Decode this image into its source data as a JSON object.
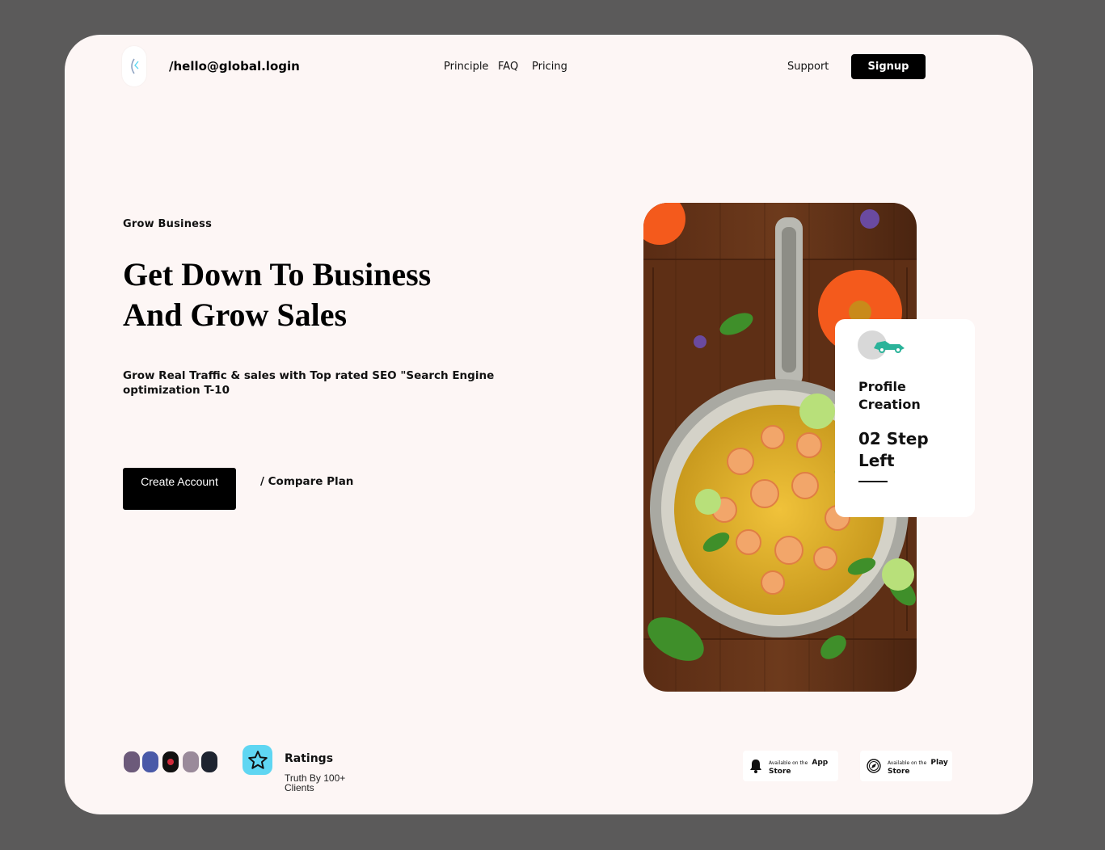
{
  "header": {
    "email": "/hello@global.login",
    "nav": [
      "Principle",
      "FAQ",
      "Pricing"
    ],
    "support": "Support",
    "signup": "Signup"
  },
  "hero": {
    "eyebrow": "Grow Business",
    "headline_line1": "Get Down To Business",
    "headline_line2": "And Grow Sales",
    "subtitle": "Grow Real Traffic & sales with Top rated SEO \"Search Engine optimization T-10",
    "create_account": "Create Account",
    "compare_plan": "/ Compare Plan"
  },
  "step_card": {
    "title": "Profile Creation",
    "count": "02 Step Left"
  },
  "social_proof": {
    "avatar_count": 5,
    "ratings_title": "Ratings",
    "ratings_sub": "Truth By 100+ Clients"
  },
  "stores": [
    {
      "small": "Available on the",
      "big": "App",
      "line2": "Store",
      "icon": "bell-icon"
    },
    {
      "small": "Available on the",
      "big": "Play",
      "line2": "Store",
      "icon": "compass-icon"
    }
  ],
  "colors": {
    "background": "#5b5a5a",
    "card": "#fdf6f5",
    "primary_button": "#000000",
    "rating_badge": "#5fd6f2",
    "accent_green": "#2bb39a"
  }
}
